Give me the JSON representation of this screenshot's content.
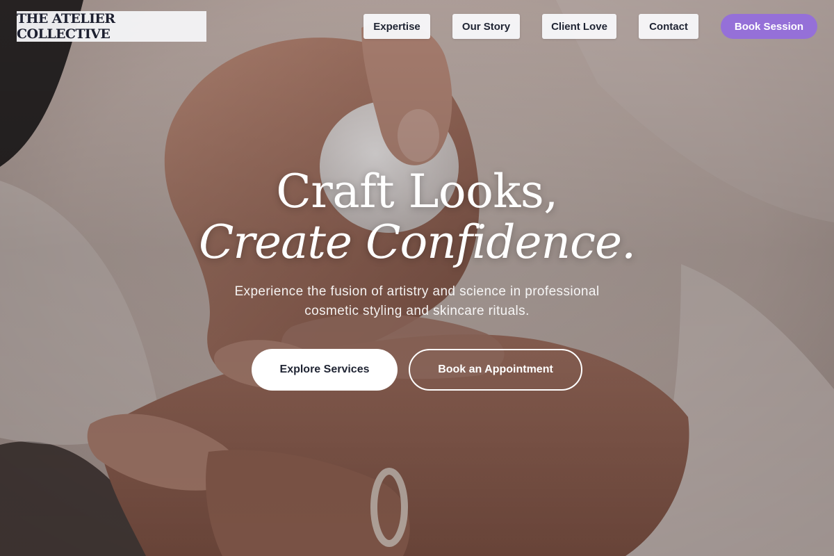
{
  "brand": {
    "name": "THE ATELIER COLLECTIVE"
  },
  "nav": {
    "items": [
      {
        "label": "Expertise"
      },
      {
        "label": "Our Story"
      },
      {
        "label": "Client Love"
      },
      {
        "label": "Contact"
      }
    ],
    "book_label": "Book Session"
  },
  "hero": {
    "headline_line1": "Craft Looks,",
    "headline_line2": "Create Confidence.",
    "subtext": "Experience the fusion of artistry and science in professional cosmetic styling and skincare rituals.",
    "primary_cta": "Explore Services",
    "secondary_cta": "Book an Appointment",
    "background_image": "hands-applying-lotion-photo"
  },
  "colors": {
    "accent": "#9570d8",
    "text_dark": "#1f2433",
    "white": "#ffffff"
  }
}
